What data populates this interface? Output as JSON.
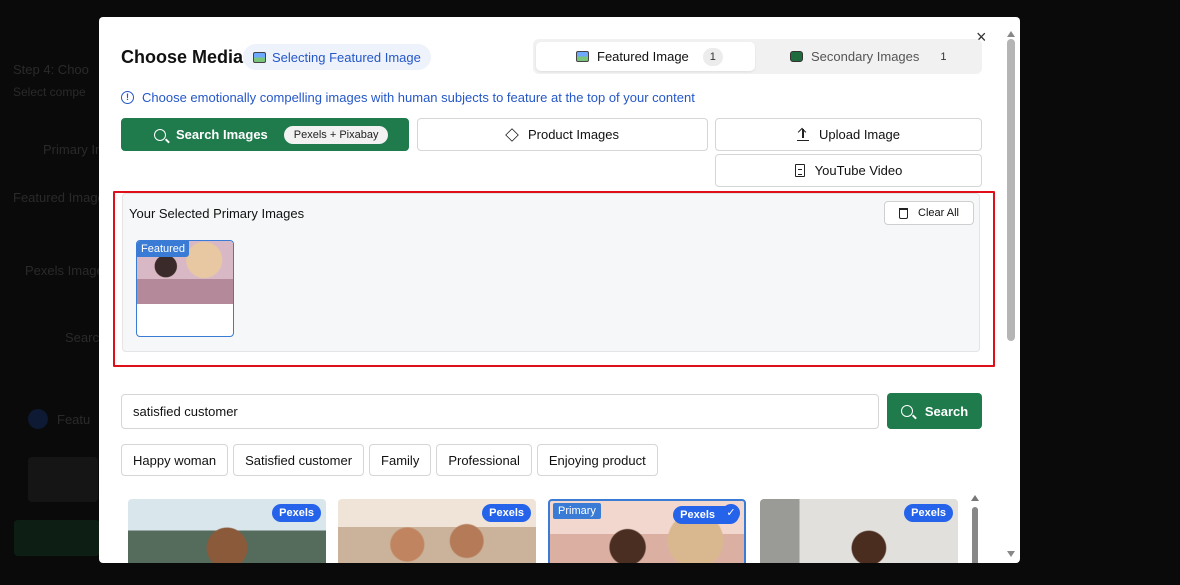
{
  "background_page": {
    "step_title": "Step 4: Choo",
    "step_sub": "Select compe",
    "primary_label": "Primary Im",
    "featured_label": "Featured Image",
    "pexels_label": "Pexels Images",
    "search_placeholder": "Searc",
    "featured_item": "Featu"
  },
  "modal": {
    "title": "Choose Media",
    "selecting_badge": "Selecting Featured Image",
    "close": "×",
    "tabs": [
      {
        "label": "Featured Image",
        "count": "1"
      },
      {
        "label": "Secondary Images",
        "count": "1"
      }
    ],
    "info_text": "Choose emotionally compelling images with human subjects to feature at the top of your content",
    "sources": {
      "search": {
        "label": "Search Images",
        "pill": "Pexels + Pixabay"
      },
      "product": {
        "label": "Product Images"
      },
      "upload": {
        "label": "Upload Image"
      },
      "youtube": {
        "label": "YouTube Video"
      }
    },
    "selected_panel": {
      "title": "Your Selected Primary Images",
      "clear_label": "Clear All",
      "items": [
        {
          "tag": "Featured"
        }
      ]
    },
    "search": {
      "value": "satisfied customer",
      "button_label": "Search"
    },
    "suggestions": [
      "Happy woman",
      "Satisfied customer",
      "Family",
      "Professional",
      "Enjoying product"
    ],
    "results": [
      {
        "source": "Pexels",
        "selected": false
      },
      {
        "source": "Pexels",
        "selected": false
      },
      {
        "source": "Pexels",
        "selected": true,
        "primary_tag": "Primary"
      },
      {
        "source": "Pexels",
        "selected": false
      }
    ]
  },
  "colors": {
    "accent_green": "#1f7a4c",
    "accent_blue": "#2557c9",
    "badge_blue": "#2563eb",
    "highlight_red": "#e0101a"
  },
  "icons": {
    "info": "info-circle-icon",
    "search": "search-icon",
    "product": "package-icon",
    "upload": "upload-icon",
    "youtube": "document-icon",
    "clear": "trash-icon",
    "check": "check-icon"
  }
}
